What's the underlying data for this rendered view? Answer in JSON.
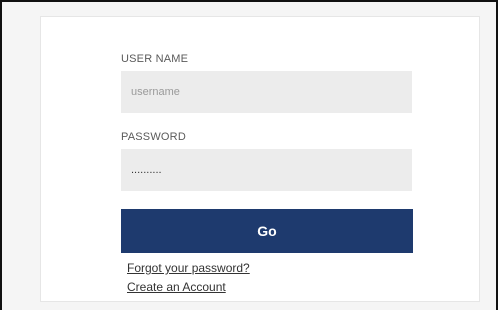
{
  "login_form": {
    "username_label": "USER NAME",
    "username_placeholder": "username",
    "username_value": "",
    "password_label": "PASSWORD",
    "password_value": "..........",
    "submit_label": "Go",
    "forgot_password_link": "Forgot your password?",
    "create_account_link": "Create an Account"
  },
  "colors": {
    "button_background": "#1e3a6e",
    "field_background": "#ececec"
  }
}
